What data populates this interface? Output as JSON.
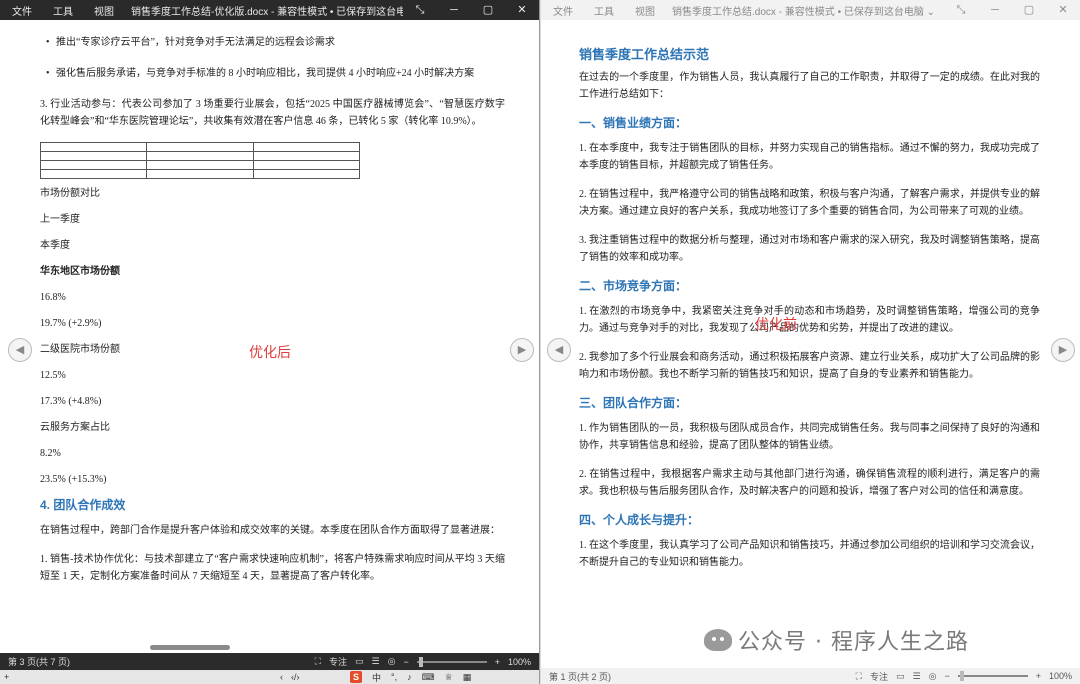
{
  "left_window": {
    "menu": [
      "文件",
      "工具",
      "视图"
    ],
    "title": "销售季度工作总结-优化版.docx - 兼容性模式 • 已保存到这台电脑 ⌄",
    "bullets": [
      "推出“专家诊疗云平台”，针对竞争对手无法满足的远程会诊需求",
      "强化售后服务承诺，与竞争对手标准的 8 小时响应相比，我司提供 4 小时响应+24 小时解决方案"
    ],
    "para3": "3. 行业活动参与：代表公司参加了 3 场重要行业展会，包括“2025 中国医疗器械博览会”、“智慧医疗数字化转型峰会”和“华东医院管理论坛”，共收集有效潜在客户信息 46 条，已转化 5 家（转化率 10.9%）。",
    "market_title": "市场份额对比",
    "prev_quarter": "上一季度",
    "this_quarter": "本季度",
    "rows": [
      {
        "label": "华东地区市场份额",
        "v1": "16.8%",
        "v2": "19.7% (+2.9%)"
      },
      {
        "label": "二级医院市场份额",
        "v1": "12.5%",
        "v2": "17.3% (+4.8%)"
      },
      {
        "label": "云服务方案占比",
        "v1": "8.2%",
        "v2": "23.5% (+15.3%)"
      }
    ],
    "heading4": "4. 团队合作成效",
    "intro4": "在销售过程中，跨部门合作是提升客户体验和成交效率的关键。本季度在团队合作方面取得了显著进展：",
    "item4_1": "1. 销售-技术协作优化：与技术部建立了“客户需求快速响应机制”，将客户特殊需求响应时间从平均 3 天缩短至 1 天，定制化方案准备时间从 7 天缩短至 4 天，显著提高了客户转化率。",
    "overlay_label": "优化后",
    "status": {
      "page": "第 3 页(共 7 页)",
      "focus": "专注",
      "zoom": "100%"
    }
  },
  "right_window": {
    "menu": [
      "文件",
      "工具",
      "视图"
    ],
    "title": "销售季度工作总结.docx - 兼容性模式 • 已保存到这台电脑 ⌄",
    "doc_title": "销售季度工作总结示范",
    "intro": "在过去的一个季度里，作为销售人员，我认真履行了自己的工作职责，并取得了一定的成绩。在此对我的工作进行总结如下：",
    "s1_title": "一、销售业绩方面：",
    "s1_p1": "1. 在本季度中，我专注于销售团队的目标，并努力实现自己的销售指标。通过不懈的努力，我成功完成了本季度的销售目标，并超额完成了销售任务。",
    "s1_p2": "2. 在销售过程中，我严格遵守公司的销售战略和政策，积极与客户沟通，了解客户需求，并提供专业的解决方案。通过建立良好的客户关系，我成功地签订了多个重要的销售合同，为公司带来了可观的业绩。",
    "s1_p3": "3. 我注重销售过程中的数据分析与整理，通过对市场和客户需求的深入研究，我及时调整销售策略，提高了销售的效率和成功率。",
    "s2_title": "二、市场竞争方面：",
    "s2_p1": "1. 在激烈的市场竞争中，我紧密关注竞争对手的动态和市场趋势，及时调整销售策略，增强公司的竞争力。通过与竞争对手的对比，我发现了公司产品的优势和劣势，并提出了改进的建议。",
    "s2_p2": "2. 我参加了多个行业展会和商务活动，通过积极拓展客户资源、建立行业关系，成功扩大了公司品牌的影响力和市场份额。我也不断学习新的销售技巧和知识，提高了自身的专业素养和销售能力。",
    "s3_title": "三、团队合作方面：",
    "s3_p1": "1. 作为销售团队的一员，我积极与团队成员合作，共同完成销售任务。我与同事之间保持了良好的沟通和协作，共享销售信息和经验，提高了团队整体的销售业绩。",
    "s3_p2": "2. 在销售过程中，我根据客户需求主动与其他部门进行沟通，确保销售流程的顺利进行，满足客户的需求。我也积极与售后服务团队合作，及时解决客户的问题和投诉，增强了客户对公司的信任和满意度。",
    "s4_title": "四、个人成长与提升：",
    "s4_p1": "1. 在这个季度里，我认真学习了公司产品知识和销售技巧，并通过参加公司组织的培训和学习交流会议，不断提升自己的专业知识和销售能力。",
    "overlay_label": "优化前",
    "status": {
      "page": "第 1 页(共 2 页)",
      "focus": "专注",
      "zoom": "100%"
    }
  },
  "taskbar": {
    "ime_lang": "中",
    "s_logo": "S"
  },
  "watermark": "公众号 · 程序人生之路"
}
